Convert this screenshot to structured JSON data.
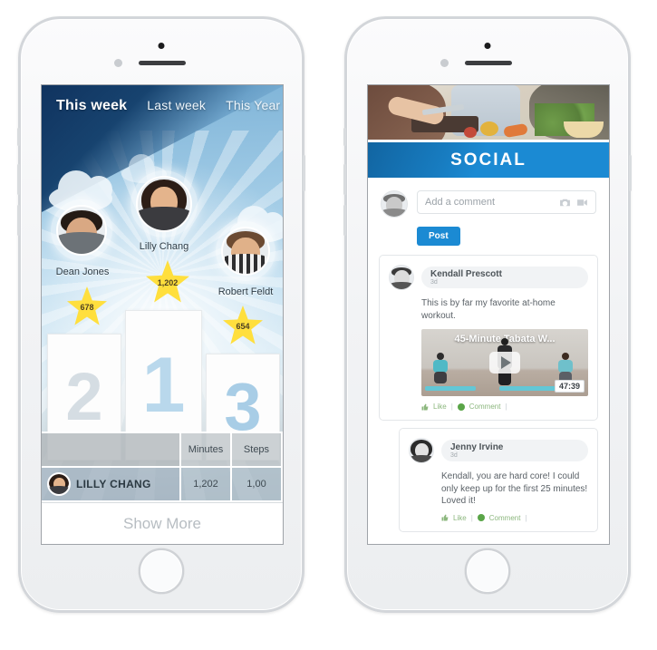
{
  "app": {
    "left_screen": "leaderboard",
    "right_screen": "social"
  },
  "leaderboard": {
    "tabs": [
      {
        "label": "This week",
        "active": true
      },
      {
        "label": "Last week",
        "active": false
      },
      {
        "label": "This Year",
        "active": false
      }
    ],
    "podium": [
      {
        "rank": "2",
        "name": "Dean Jones",
        "score": "678"
      },
      {
        "rank": "1",
        "name": "Lilly Chang",
        "score": "1,202"
      },
      {
        "rank": "3",
        "name": "Robert Feldt",
        "score": "654"
      }
    ],
    "table": {
      "headers": [
        "",
        "Minutes",
        "Steps"
      ],
      "rows": [
        {
          "name": "LILLY CHANG",
          "minutes": "1,202",
          "steps": "1,00"
        }
      ]
    },
    "show_more_label": "Show More"
  },
  "social": {
    "title": "SOCIAL",
    "composer": {
      "placeholder": "Add a comment",
      "post_label": "Post",
      "camera_icon": "camera-icon",
      "video_icon": "video-camera-icon"
    },
    "posts": [
      {
        "author": "Kendall Prescott",
        "time": "3d",
        "text": "This is by far my favorite at-home workout.",
        "video": {
          "title": "45-Minute Tabata W...",
          "duration": "47:39",
          "play_icon": "play-icon"
        },
        "actions": {
          "like": "Like",
          "comment": "Comment",
          "separator": "|"
        }
      },
      {
        "author": "Jenny Irvine",
        "time": "3d",
        "text": "Kendall, you are hard core! I could only keep up for the first 25 minutes! Loved it!",
        "actions": {
          "like": "Like",
          "comment": "Comment",
          "separator": "|"
        }
      }
    ]
  },
  "colors": {
    "brand_blue": "#1b8ad3",
    "star_yellow": "#ffdf3d",
    "action_green": "#8cb77e",
    "dark_navy": "#10335f"
  }
}
